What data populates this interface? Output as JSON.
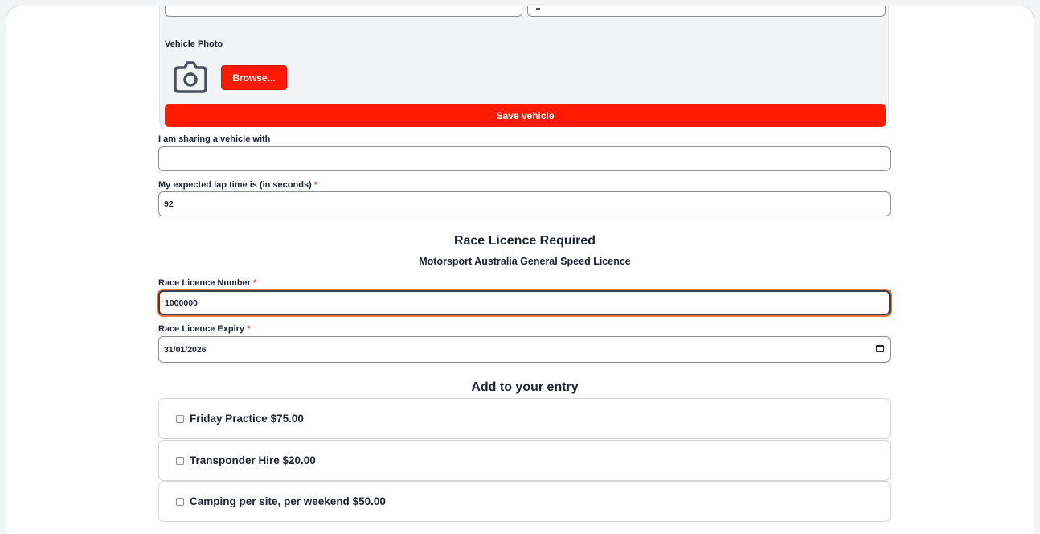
{
  "vehicle": {
    "photo_label": "Vehicle Photo",
    "browse_label": "Browse...",
    "save_label": "Save vehicle"
  },
  "form": {
    "sharing_label": "I am sharing a vehicle with",
    "sharing_value": "",
    "laptime_label": "My expected lap time is (in seconds)",
    "laptime_value": "92",
    "required_mark": "*"
  },
  "licence": {
    "heading": "Race Licence Required",
    "subheading": "Motorsport Australia General Speed Licence",
    "number_label": "Race Licence Number",
    "number_value": "1000000",
    "expiry_label": "Race Licence Expiry",
    "expiry_value": "31/01/2026"
  },
  "addons": {
    "heading": "Add to your entry",
    "items": [
      {
        "label": "Friday Practice $75.00",
        "checked": false
      },
      {
        "label": "Transponder Hire $20.00",
        "checked": false
      },
      {
        "label": "Camping per site, per weekend $50.00",
        "checked": false
      }
    ]
  },
  "icons": {
    "camera": "camera-icon",
    "calendar": "calendar-icon",
    "checkbox": "checkbox-icon"
  },
  "colors": {
    "accent": "#ff1a00",
    "focus_ring": "#f0763a",
    "required": "#e03a2e",
    "text": "#1c2230",
    "panel_bg": "#f2f3f5"
  }
}
